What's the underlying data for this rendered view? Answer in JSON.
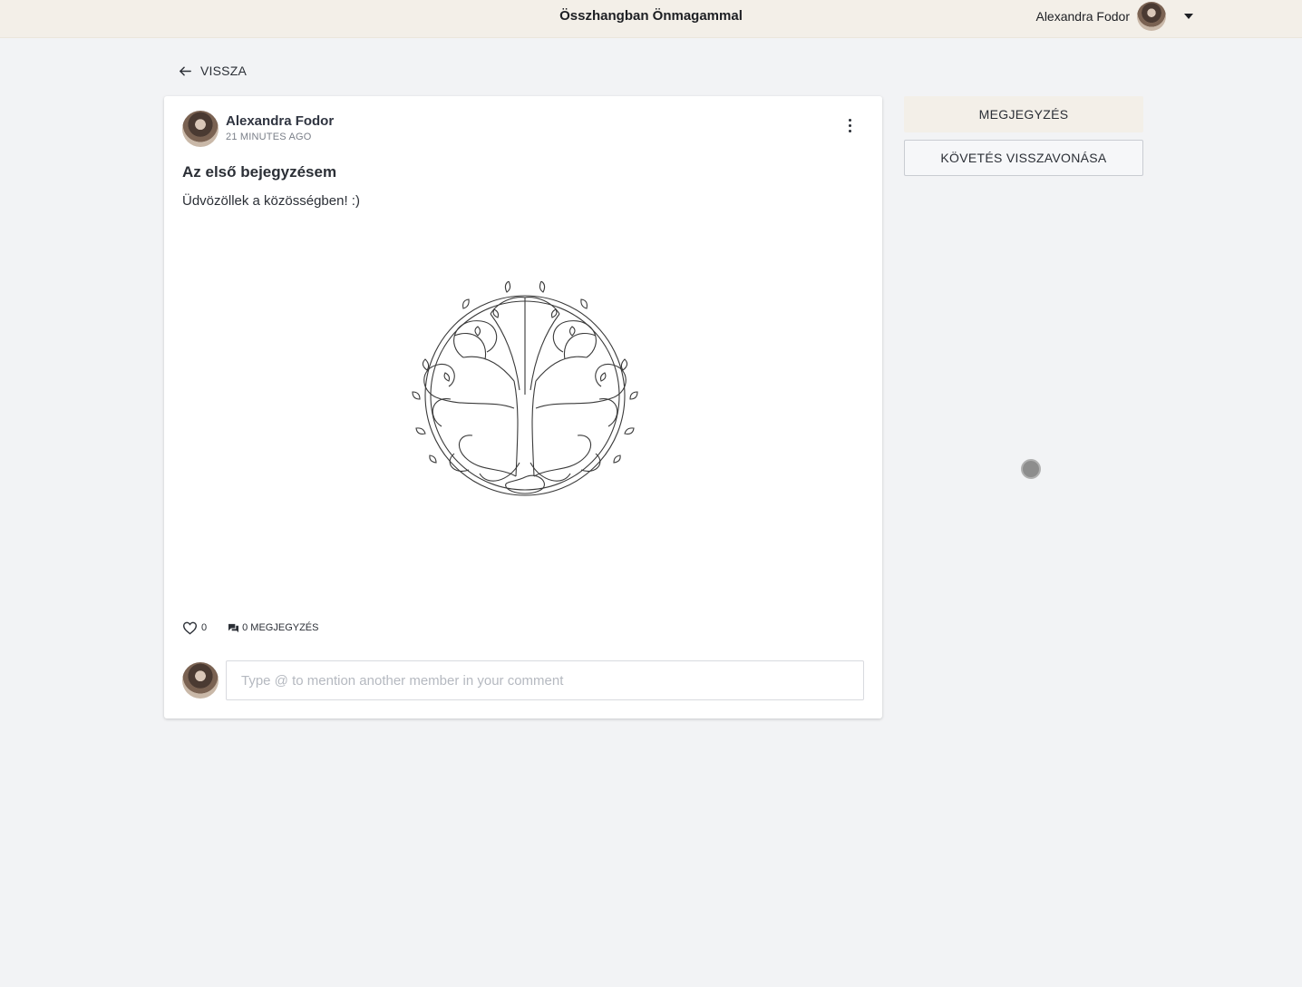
{
  "header": {
    "site_title": "Összhangban Önmagammal",
    "user_name": "Alexandra Fodor"
  },
  "back_link": {
    "label": "VISSZA"
  },
  "post": {
    "author_name": "Alexandra Fodor",
    "time_ago": "21 MINUTES AGO",
    "title": "Az első bejegyzésem",
    "body": "Üdvözöllek a közösségben! :)",
    "like_count": "0",
    "comment_label": "0 MEGJEGYZÉS",
    "comment_placeholder": "Type @ to mention another member in your comment"
  },
  "sidebar": {
    "primary_button": "MEGJEGYZÉS",
    "secondary_button": "KÖVETÉS VISSZAVONÁSA"
  },
  "icons": {
    "back": "arrow-left-icon",
    "menu": "more-vertical-icon",
    "like": "heart-icon",
    "comments": "comment-icon",
    "dropdown": "chevron-down-icon"
  },
  "colors": {
    "header_bg": "#f3efe8",
    "page_bg": "#f2f3f5",
    "card_bg": "#ffffff",
    "text": "#2b2f36"
  }
}
